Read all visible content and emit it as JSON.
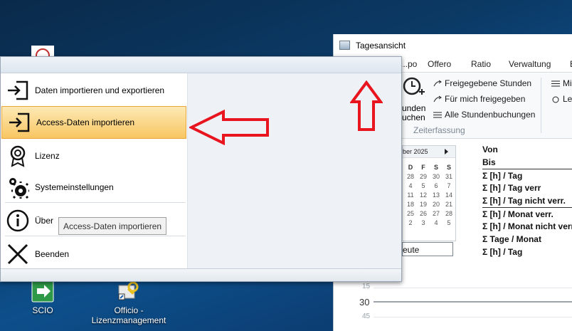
{
  "desktop": {
    "icons": [
      {
        "label": "SCIO"
      },
      {
        "label": "Officio -\nLizenzmanagement",
        "line1": "Officio -",
        "line2": "Lizenzmanagement"
      }
    ]
  },
  "window": {
    "title": "Tagesansicht",
    "tabs": [
      "...po",
      "Offero",
      "Ratio",
      "Verwaltung",
      "E"
    ],
    "ribbon": {
      "big_button_line1": "unden",
      "big_button_line2": "uchen",
      "items": [
        "Freigegebene Stunden",
        "Für mich freigegeben",
        "Alle Stundenbuchungen"
      ],
      "right_items": [
        "Mi",
        "Lei"
      ],
      "group_label": "Zeiterfassung"
    },
    "calendar": {
      "month_label": "ber 2025",
      "day_headers": [
        "D",
        "F",
        "S",
        "S"
      ],
      "rows": [
        [
          "28",
          "29",
          "30",
          "31"
        ],
        [
          "4",
          "5",
          "6",
          "7"
        ],
        [
          "11",
          "12",
          "13",
          "14"
        ],
        [
          "18",
          "19",
          "20",
          "21"
        ],
        [
          "25",
          "26",
          "27",
          "28"
        ],
        [
          "2",
          "3",
          "4",
          "5"
        ]
      ],
      "today_value": "eute"
    },
    "summary": {
      "von": "Von",
      "bis": "Bis",
      "rows": [
        "Σ [h] / Tag",
        "Σ [h] / Tag verr",
        "Σ [h] / Tag nicht verr.",
        "Σ [h] / Monat verr.",
        "Σ [h] / Monat nicht verr",
        "Σ Tage / Monat",
        "Σ [h] / Tag"
      ]
    },
    "dayview": {
      "minor1": "15",
      "major": "30",
      "minor2": "45"
    }
  },
  "backstage": {
    "items": [
      {
        "label": "Daten importieren und exportieren",
        "icon": "import-arrow-icon"
      },
      {
        "label": "Access-Daten importieren",
        "icon": "import-arrow-icon",
        "selected": true
      },
      {
        "label": "Lizenz",
        "icon": "license-badge-icon"
      },
      {
        "label": "Systemeinstellungen",
        "icon": "gears-icon"
      },
      {
        "label": "Über",
        "icon": "info-icon"
      },
      {
        "label": "Beenden",
        "icon": "close-icon"
      }
    ],
    "tooltip": "Access-Daten importieren"
  },
  "colors": {
    "selected_bg": "#f8c662",
    "menu_button": "#2b62b3",
    "arrow_red": "#e8141e"
  }
}
